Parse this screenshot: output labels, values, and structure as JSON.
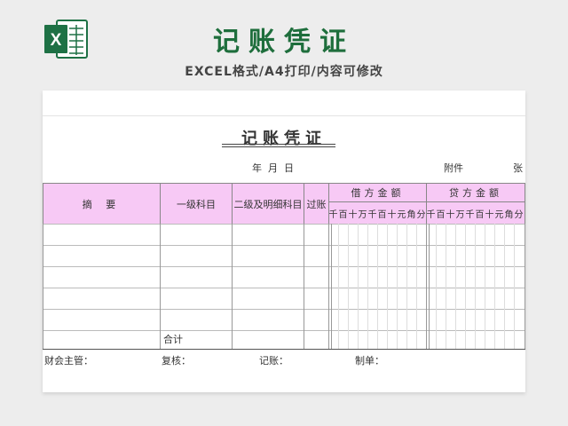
{
  "banner": {
    "title": "记账凭证",
    "subtitle": "EXCEL格式/A4打印/内容可修改",
    "logo_letter": "X",
    "logo_color": "#1e7145"
  },
  "sheet": {
    "title": "记账凭证",
    "date_label": "年  月  日",
    "attachment_label": "附件",
    "sheets_unit": "张"
  },
  "table": {
    "headers": {
      "summary": "摘  要",
      "level1": "一级科目",
      "level2": "二级及明细科目",
      "posted": "过账",
      "debit": "借方金额",
      "credit": "贷方金额"
    },
    "digit_labels": [
      "千",
      "百",
      "十",
      "万",
      "千",
      "百",
      "十",
      "元",
      "角",
      "分"
    ],
    "total_label": "合计",
    "empty_rows": 5
  },
  "footer": {
    "supervisor": "财会主管：",
    "reviewer": "复核：",
    "bookkeeper": "记账：",
    "preparer": "制单："
  },
  "colors": {
    "header_bg": "#f7c9f5",
    "title_green": "#1e6e3c"
  }
}
